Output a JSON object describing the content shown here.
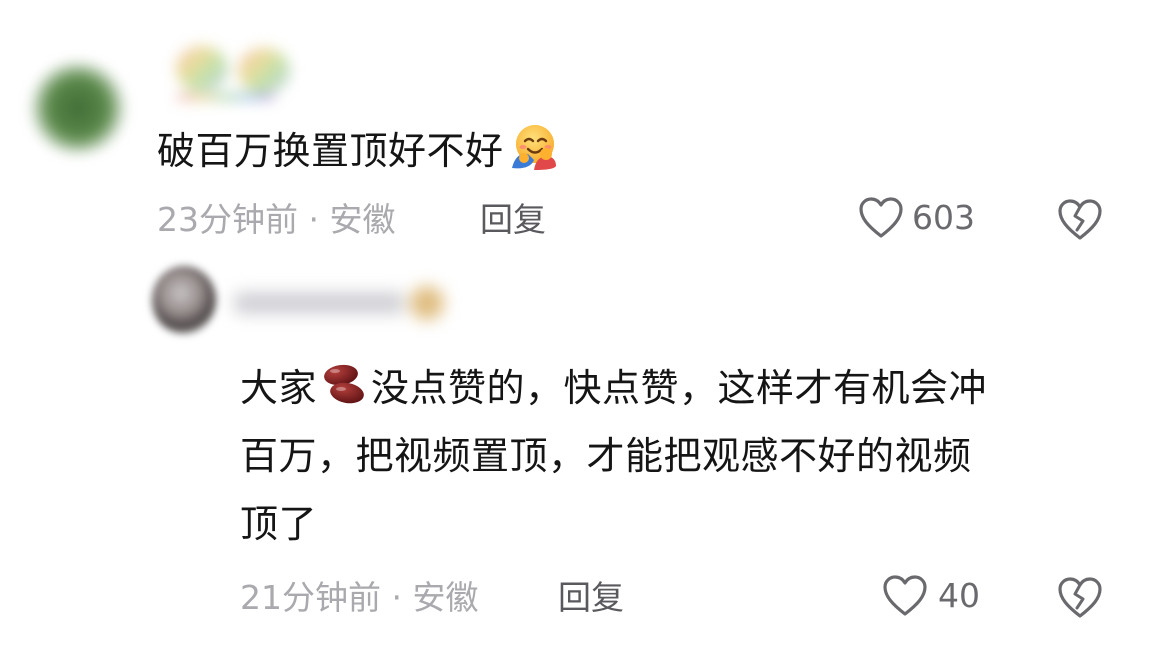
{
  "comments": [
    {
      "text": "破百万换置顶好不好",
      "emoji": "smiling-face-with-hearts-hugging",
      "time": "23分钟前",
      "separator": "·",
      "location": "安徽",
      "reply_label": "回复",
      "likes": "603"
    },
    {
      "text_lines": [
        "大家",
        "没点赞的，快点赞，这样才有机会冲",
        "百万，把视频置顶，才能把观感不好的视频",
        "顶了"
      ],
      "emoji": "beans",
      "time": "21分钟前",
      "separator": "·",
      "location": "安徽",
      "reply_label": "回复",
      "likes": "40"
    }
  ],
  "icons": {
    "like": "heart-outline-icon",
    "dislike": "broken-heart-icon"
  },
  "colors": {
    "text": "#151515",
    "meta": "#a9a9ae",
    "reply": "#5a5a5e",
    "icon": "#6a6a6e"
  }
}
